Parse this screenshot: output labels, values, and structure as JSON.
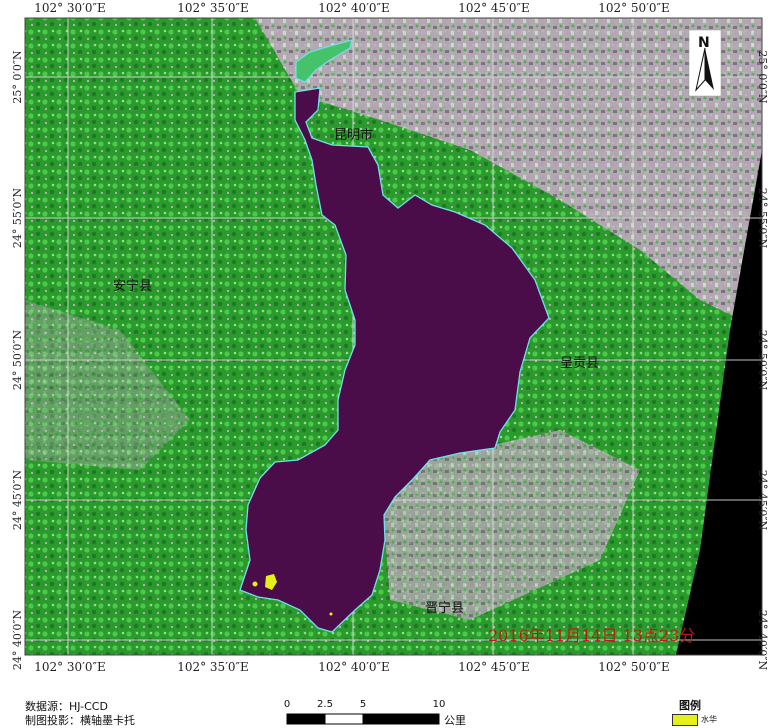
{
  "map": {
    "longitude_labels": [
      "102° 30′0″E",
      "102° 35′0″E",
      "102° 40′0″E",
      "102° 45′0″E",
      "102° 50′0″E"
    ],
    "latitude_labels": [
      "25° 0′0″N",
      "24° 55′0″N",
      "24° 50′0″N",
      "24° 45′0″N",
      "24° 40′0″N"
    ],
    "places": {
      "kunming": "昆明市",
      "anning": "安宁县",
      "chenggong": "呈贡县",
      "jinning": "晋宁县"
    },
    "timestamp": "2016年11月14日  13点23分",
    "north_arrow": "N",
    "colors": {
      "water": "#4a0d4a",
      "shoreline": "#6fe0ee",
      "vegetation": "#2fae2f",
      "urban": "#c9a8c9",
      "bloom": "#e4f01a",
      "timestamp": "#c81414"
    }
  },
  "footer": {
    "data_source": "数据源：HJ-CCD",
    "projection": "制图投影：横轴墨卡托"
  },
  "scale_bar": {
    "ticks": [
      "0",
      "2.5",
      "5",
      "10"
    ],
    "unit": "公里"
  },
  "legend": {
    "title": "图例",
    "items": [
      {
        "label": "水华",
        "color": "#e4f01a"
      }
    ]
  }
}
